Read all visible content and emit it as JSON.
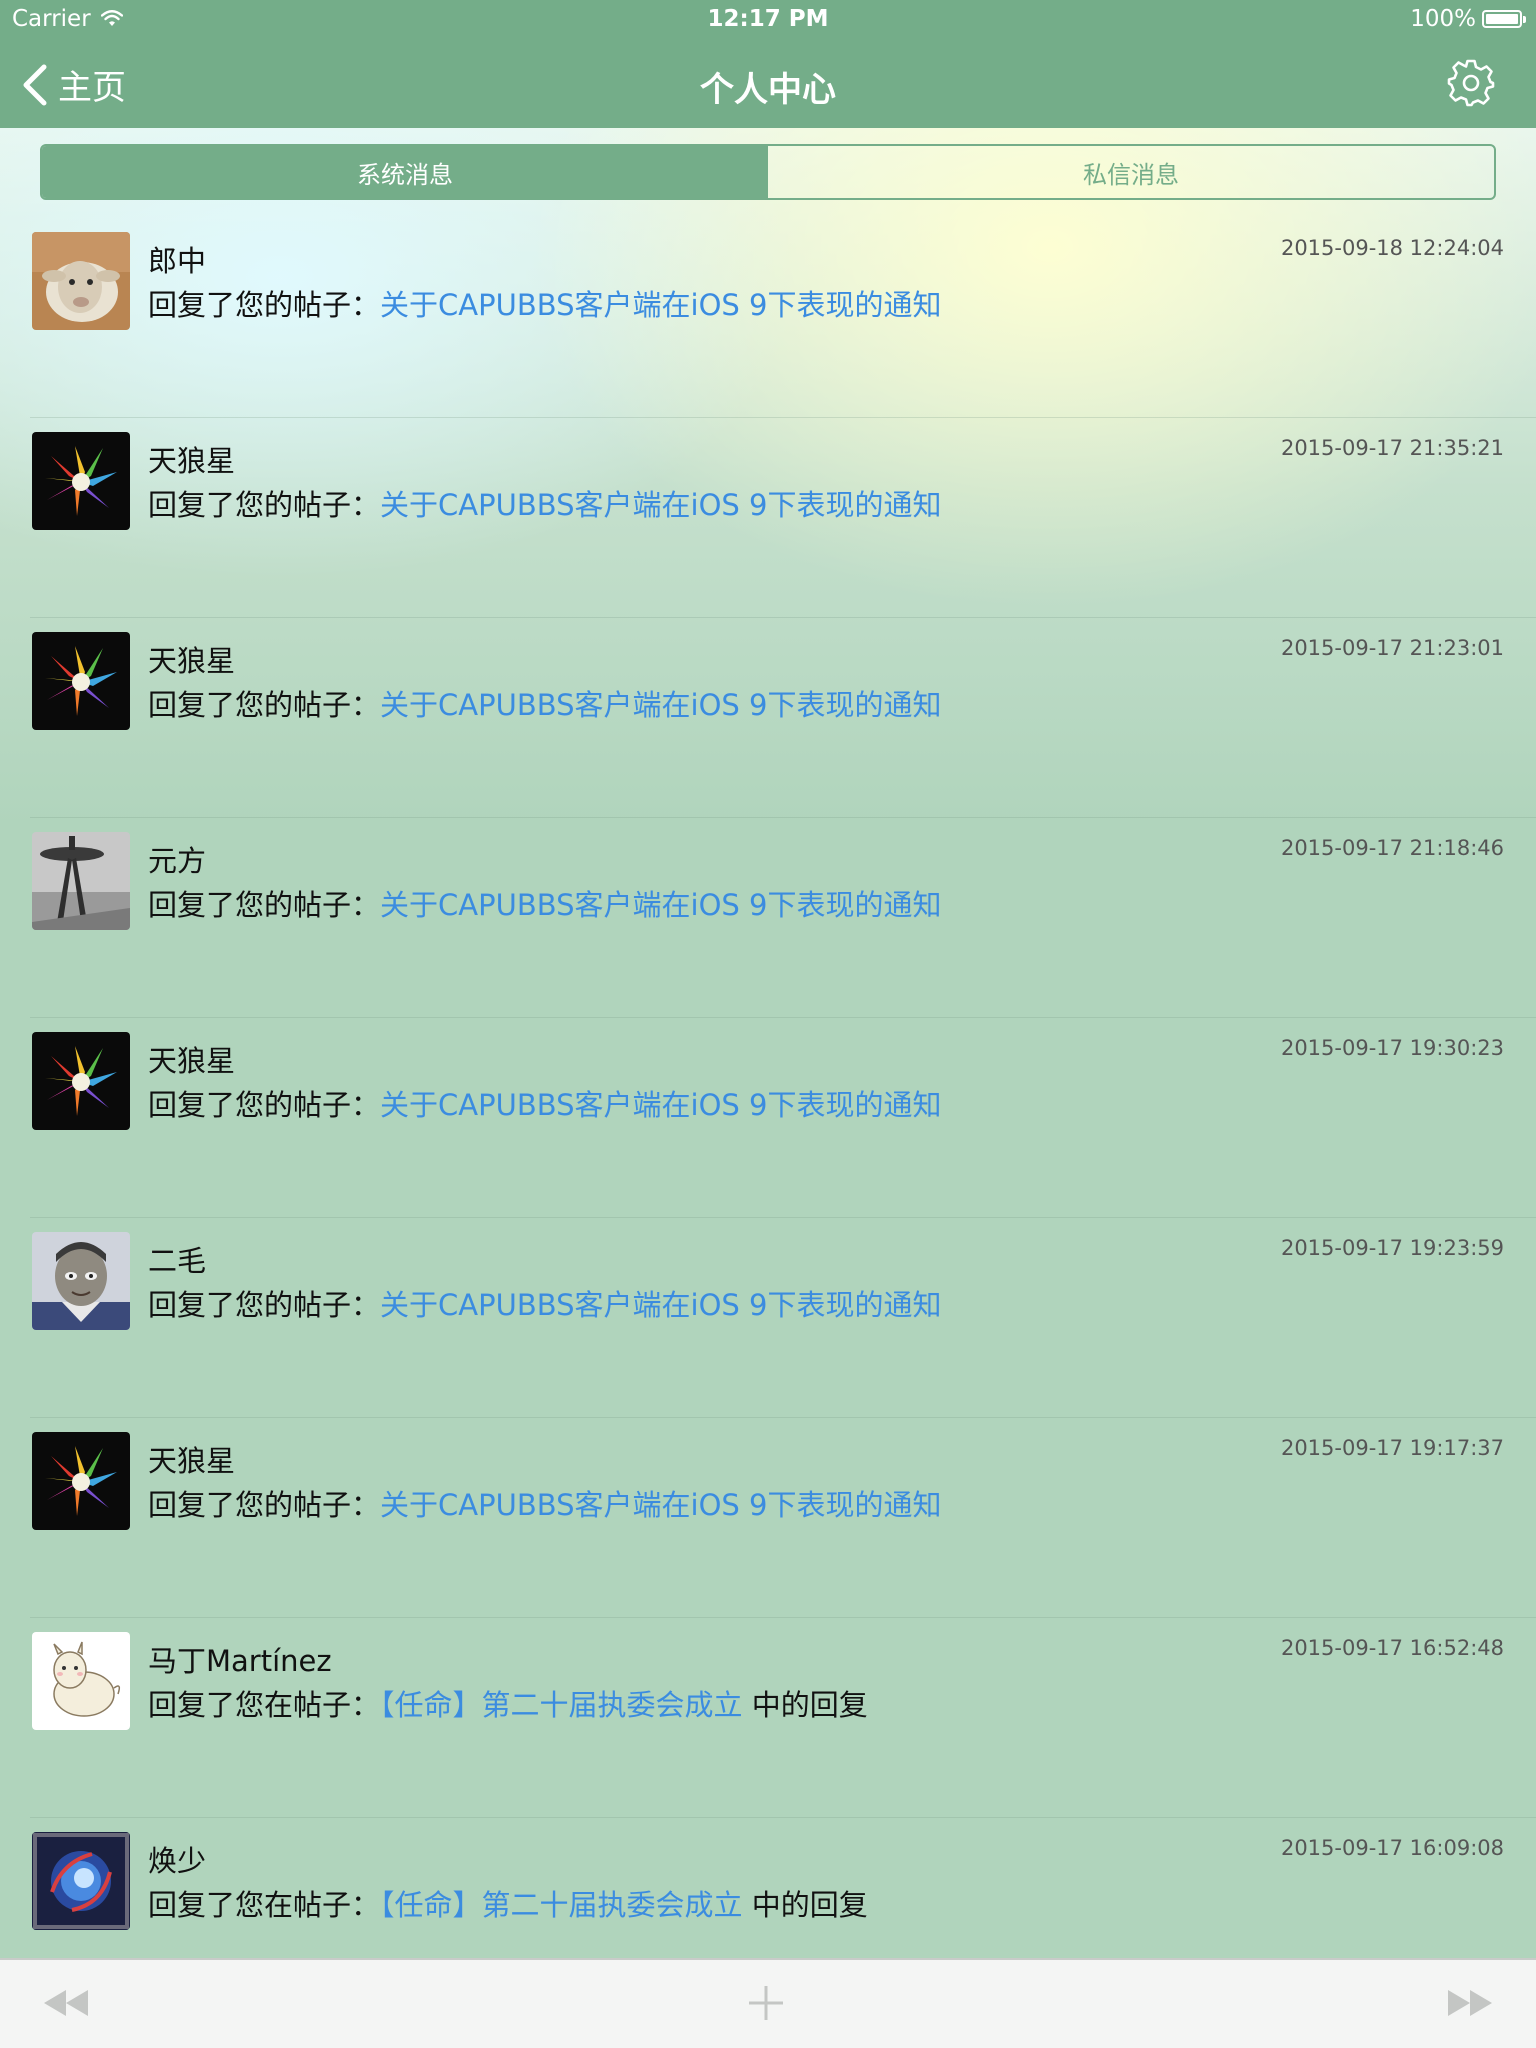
{
  "status_bar": {
    "carrier": "Carrier",
    "time": "12:17 PM",
    "battery": "100%"
  },
  "nav": {
    "back_label": "主页",
    "title": "个人中心"
  },
  "tabs": [
    {
      "label": "系统消息",
      "active": true
    },
    {
      "label": "私信消息",
      "active": false
    }
  ],
  "messages": [
    {
      "name": "郎中",
      "time": "2015-09-18 12:24:04",
      "action": "回复了您的帖子：",
      "link": "关于CAPUBBS客户端在iOS 9下表现的通知",
      "suffix": "",
      "avatar": "sheep-avatar"
    },
    {
      "name": "天狼星",
      "time": "2015-09-17 21:35:21",
      "action": "回复了您的帖子：",
      "link": "关于CAPUBBS客户端在iOS 9下表现的通知",
      "suffix": "",
      "avatar": "color-burst-avatar"
    },
    {
      "name": "天狼星",
      "time": "2015-09-17 21:23:01",
      "action": "回复了您的帖子：",
      "link": "关于CAPUBBS客户端在iOS 9下表现的通知",
      "suffix": "",
      "avatar": "color-burst-avatar"
    },
    {
      "name": "元方",
      "time": "2015-09-17 21:18:46",
      "action": "回复了您的帖子：",
      "link": "关于CAPUBBS客户端在iOS 9下表现的通知",
      "suffix": "",
      "avatar": "tower-avatar"
    },
    {
      "name": "天狼星",
      "time": "2015-09-17 19:30:23",
      "action": "回复了您的帖子：",
      "link": "关于CAPUBBS客户端在iOS 9下表现的通知",
      "suffix": "",
      "avatar": "color-burst-avatar"
    },
    {
      "name": "二毛",
      "time": "2015-09-17 19:23:59",
      "action": "回复了您的帖子：",
      "link": "关于CAPUBBS客户端在iOS 9下表现的通知",
      "suffix": "",
      "avatar": "cartoon-face-avatar"
    },
    {
      "name": "天狼星",
      "time": "2015-09-17 19:17:37",
      "action": "回复了您的帖子：",
      "link": "关于CAPUBBS客户端在iOS 9下表现的通知",
      "suffix": "",
      "avatar": "color-burst-avatar"
    },
    {
      "name": "马丁Martínez",
      "time": "2015-09-17 16:52:48",
      "action": "回复了您在帖子：",
      "link": "【任命】第二十届执委会成立",
      "suffix": " 中的回复",
      "avatar": "alpaca-avatar"
    },
    {
      "name": "焕少",
      "time": "2015-09-17 16:09:08",
      "action": "回复了您在帖子：",
      "link": "【任命】第二十届执委会成立",
      "suffix": " 中的回复",
      "avatar": "blue-orb-avatar"
    }
  ],
  "toolbar": {
    "first_icon": "rewind-icon",
    "add_icon": "plus-icon",
    "last_icon": "fast-forward-icon"
  },
  "colors": {
    "nav_bg": "#74ad89",
    "link": "#3b8ce0",
    "list_bg": "#b0d4bc"
  }
}
